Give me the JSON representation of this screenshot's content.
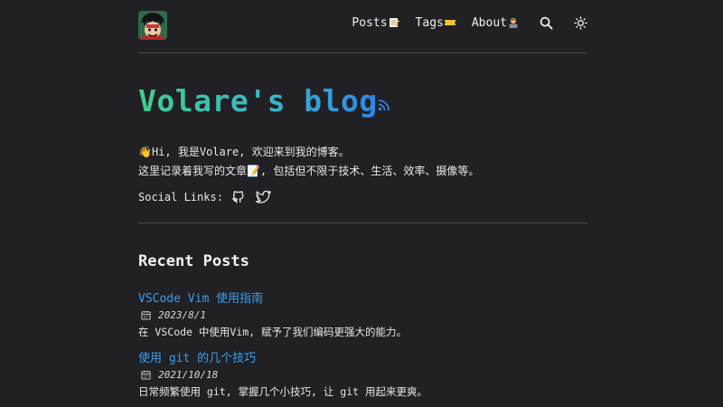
{
  "header": {
    "nav": [
      {
        "label": "Posts",
        "emoji": "memo-icon"
      },
      {
        "label": "Tags",
        "emoji": "ticket-icon"
      },
      {
        "label": "About",
        "emoji": "person-icon"
      }
    ],
    "search_icon": "search-icon",
    "theme_icon": "sun-icon"
  },
  "hero": {
    "title": "Volare's blog",
    "rss_icon": "rss-icon",
    "intro_line1": "👋Hi, 我是Volare, 欢迎来到我的博客。",
    "intro_line2": "这里记录着我写的文章📝, 包括但不限于技术、生活、效率、摄像等。",
    "social_label": "Social Links:",
    "social": [
      "github-icon",
      "twitter-icon"
    ]
  },
  "recent": {
    "title": "Recent Posts",
    "posts": [
      {
        "title": "VSCode Vim 使用指南",
        "date": "2023/8/1",
        "desc": "在 VSCode 中使用Vim, 赋予了我们编码更强大的能力。"
      },
      {
        "title": "使用 git 的几个技巧",
        "date": "2021/10/18",
        "desc": "日常频繁使用 git, 掌握几个小技巧, 让 git 用起来更爽。"
      }
    ]
  },
  "colors": {
    "background": "#212024",
    "link": "#3a9ff0",
    "gradient_start": "#3fcf8e",
    "gradient_end": "#2f86e8"
  }
}
